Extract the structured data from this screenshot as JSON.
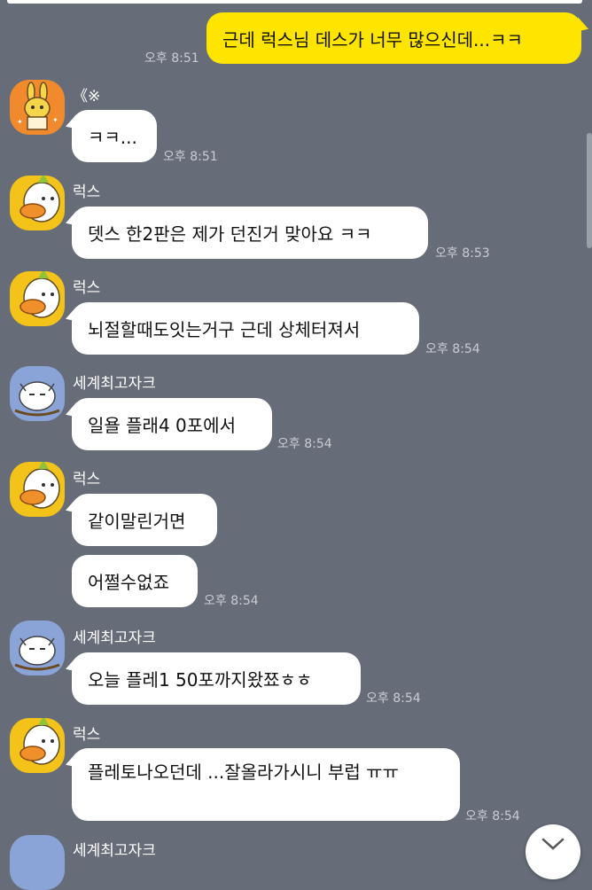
{
  "messages": [
    {
      "type": "sent",
      "text": "근데 럭스님 데스가 너무 많으신데...ㅋㅋ",
      "time": "오후 8:51"
    },
    {
      "type": "recv",
      "sender": "《※",
      "text": "ㅋㅋ...",
      "time": "오후 8:51",
      "avatar": "rabbit-avatar"
    },
    {
      "type": "recv",
      "sender": "럭스",
      "text": "뎃스 한2판은 제가 던진거 맞아요 ㅋㅋ",
      "time": "오후 8:53",
      "avatar": "duck-avatar"
    },
    {
      "type": "recv",
      "sender": "럭스",
      "text": "뇌절할때도잇는거구 근데 상체터져서",
      "time": "오후 8:54",
      "avatar": "duck-avatar"
    },
    {
      "type": "recv",
      "sender": "세계최고자크",
      "text": "일욜 플래4 0포에서",
      "time": "오후 8:54",
      "avatar": "cat-avatar"
    },
    {
      "type": "recv",
      "sender": "럭스",
      "text": "같이말린거면",
      "avatar": "duck-avatar"
    },
    {
      "type": "recv",
      "text": "어쩔수없죠",
      "time": "오후 8:54"
    },
    {
      "type": "recv",
      "sender": "세계최고자크",
      "text": "오늘 플레1 50포까지왔쬬ㅎㅎ",
      "time": "오후 8:54",
      "avatar": "cat-avatar"
    },
    {
      "type": "recv",
      "sender": "럭스",
      "text": "플레토나오던데 ...잘올라가시니 부럽 ㅠㅠ",
      "time": "오후 8:54",
      "avatar": "duck-avatar"
    },
    {
      "type": "recv",
      "sender": "세계최고자크",
      "avatar": "cat-avatar"
    }
  ],
  "scroll_button": {
    "icon": "chevron-down-icon"
  },
  "colors": {
    "background": "#666d78",
    "sent_bubble": "#fee500",
    "received_bubble": "#ffffff"
  }
}
